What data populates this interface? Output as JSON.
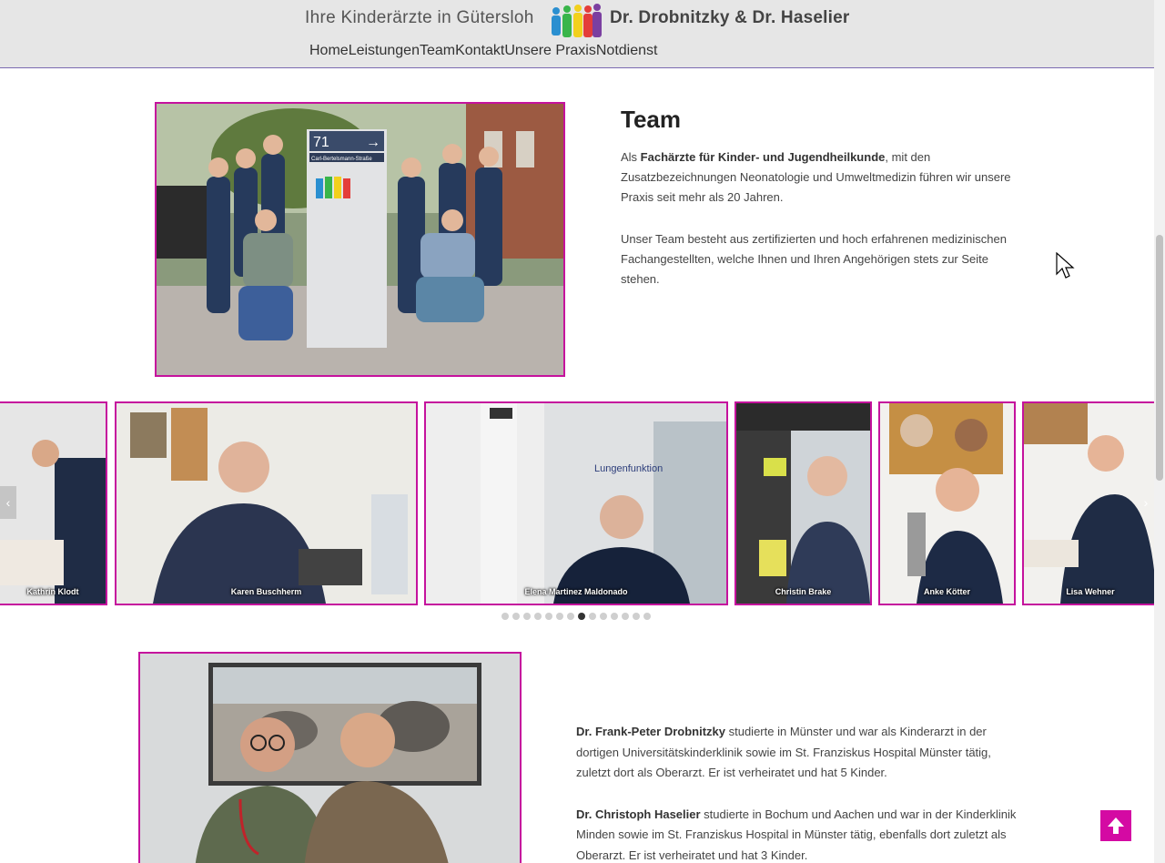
{
  "header": {
    "tagline": "Ihre Kinderärzte in Gütersloh",
    "doctors": "Dr. Drobnitzky & Dr. Haselier"
  },
  "nav": {
    "items": [
      {
        "label": "Home"
      },
      {
        "label": "Leistungen"
      },
      {
        "label": "Team"
      },
      {
        "label": "Kontakt"
      },
      {
        "label": "Unsere Praxis"
      },
      {
        "label": "Notdienst"
      }
    ]
  },
  "team": {
    "title": "Team",
    "p1_pre": "Als ",
    "p1_bold": "Fachärzte für Kinder- und Jugendheilkunde",
    "p1_post": ", mit den Zusatzbezeichnungen Neonatologie und Umweltmedizin führen wir unsere Praxis seit mehr als 20 Jahren.",
    "p2": "Unser Team besteht aus zertifizierten und hoch erfahrenen medizinischen Fachangestellten, welche Ihnen und Ihren Angehörigen stets zur Seite stehen.",
    "photo_sign_number": "71",
    "photo_sign_street": "Carl-Bertelsmann-Straße"
  },
  "carousel": {
    "slides": [
      {
        "caption": "Kathrin Klodt"
      },
      {
        "caption": "Karen Buschherm"
      },
      {
        "caption": "Elena Martinez Maldonado"
      },
      {
        "caption": "Christin Brake"
      },
      {
        "caption": "Anke Kötter"
      },
      {
        "caption": "Lisa Wehner"
      }
    ],
    "wall_sign": "Lungenfunktion",
    "dot_count": 14,
    "active_dot": 7
  },
  "doctors": {
    "p1_bold": "Dr. Frank-Peter Drobnitzky",
    "p1_text": " studierte in Münster und war als Kinderarzt in der dortigen Universitätskinderklinik sowie im St. Franziskus Hospital Münster tätig, zuletzt dort als Oberarzt. Er ist verheiratet und hat 5 Kinder.",
    "p2_bold": "Dr. Christoph Haselier",
    "p2_text": " studierte in Bochum und Aachen und war in der Kinderklinik Minden sowie im St. Franziskus Hospital in Münster tätig, ebenfalls dort zuletzt als Oberarzt. Er ist verheiratet und hat 3 Kinder."
  },
  "colors": {
    "accent": "#c5129d",
    "nav": "#cc0fa0",
    "header_bg": "#e6e6e6"
  },
  "icons": {
    "arrow_left": "‹",
    "arrow_right": "›",
    "to_top": "arrow-up-icon"
  }
}
